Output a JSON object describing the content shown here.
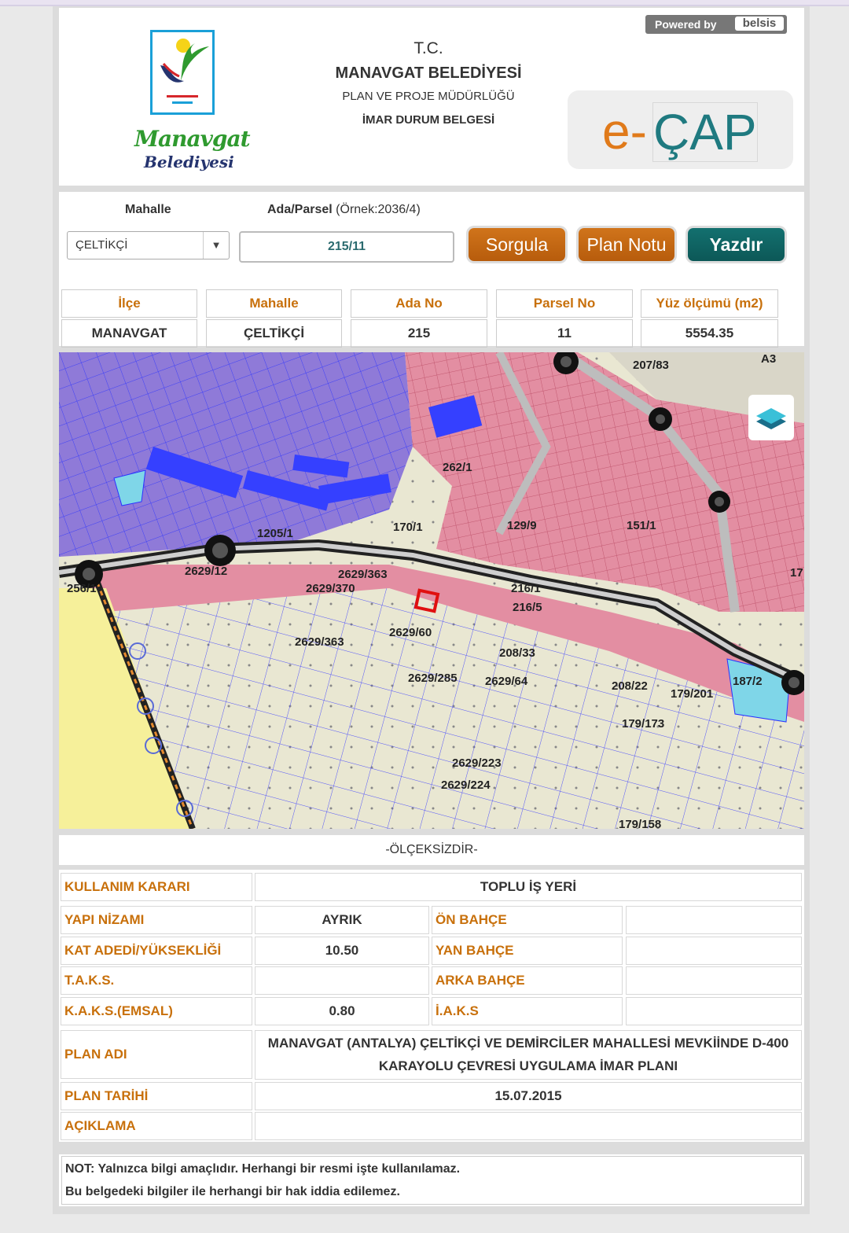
{
  "header": {
    "tc": "T.C.",
    "belediye": "MANAVGAT BELEDİYESİ",
    "mudurluk": "PLAN VE PROJE MÜDÜRLÜĞÜ",
    "belge": "İMAR DURUM BELGESİ",
    "logo_text_1": "Manavgat",
    "logo_text_2": "Belediyesi",
    "powered_by": "Powered by",
    "powered_brand": "belsis",
    "ecap_e": "e-",
    "ecap_rest": "ÇAP"
  },
  "query": {
    "mahalle_label": "Mahalle",
    "ada_parsel_label": "Ada/Parsel",
    "ada_parsel_hint": "(Örnek:2036/4)",
    "mahalle_value": "ÇELTİKÇİ",
    "ada_parsel_value": "215/11",
    "buttons": {
      "sorgula": "Sorgula",
      "plan_notu": "Plan Notu",
      "yazdir": "Yazdır"
    }
  },
  "parcel_table": {
    "headers": [
      "İlçe",
      "Mahalle",
      "Ada No",
      "Parsel No",
      "Yüz ölçümü (m2)"
    ],
    "values": [
      "MANAVGAT",
      "ÇELTİKÇİ",
      "215",
      "11",
      "5554.35"
    ]
  },
  "map": {
    "labels": [
      "207/83",
      "A3",
      "262/1",
      "170/1",
      "129/9",
      "151/1",
      "1205/1",
      "2629/12",
      "2629/363",
      "2629/370",
      "216/1",
      "216/5",
      "17",
      "2629/60",
      "2629/363",
      "208/33",
      "2629/285",
      "2629/64",
      "208/22",
      "179/201",
      "187/2",
      "179/173",
      "2629/223",
      "2629/224",
      "179/158",
      "256/1"
    ]
  },
  "scale_text": "-ÖLÇEKSİZDİR-",
  "info": {
    "kullanim_karari_label": "KULLANIM KARARI",
    "kullanim_karari": "TOPLU İŞ YERİ",
    "yapi_nizami_label": "YAPI NİZAMI",
    "yapi_nizami": "AYRIK",
    "on_bahce_label": "ÖN BAHÇE",
    "on_bahce": "",
    "kat_label": "KAT ADEDİ/YÜKSEKLİĞİ",
    "kat": "10.50",
    "yan_bahce_label": "YAN BAHÇE",
    "yan_bahce": "",
    "taks_label": "T.A.K.S.",
    "taks": "",
    "arka_bahce_label": "ARKA BAHÇE",
    "arka_bahce": "",
    "kaks_label": "K.A.K.S.(EMSAL)",
    "kaks": "0.80",
    "iaks_label": "İ.A.K.S",
    "iaks": "",
    "plan_adi_label": "PLAN ADI",
    "plan_adi_1": "MANAVGAT (ANTALYA) ÇELTİKÇİ VE DEMİRCİLER MAHALLESİ MEVKİİNDE D-400",
    "plan_adi_2": "KARAYOLU ÇEVRESİ UYGULAMA İMAR PLANI",
    "plan_tarihi_label": "PLAN TARİHİ",
    "plan_tarihi": "15.07.2015",
    "aciklama_label": "AÇIKLAMA",
    "aciklama": ""
  },
  "note": {
    "line1": "NOT: Yalnızca bilgi amaçlıdır. Herhangi bir resmi işte kullanılamaz.",
    "line2": "Bu belgedeki bilgiler ile herhangi bir hak iddia edilemez."
  },
  "colors": {
    "accent_orange": "#c8700b",
    "button_orange": "#c7680f",
    "button_teal": "#0f6665",
    "plan_pink": "#e58a9e",
    "plan_purple": "#8a73d6",
    "plan_blue_lines": "#2a32ff",
    "plan_yellow": "#f6f09a"
  }
}
